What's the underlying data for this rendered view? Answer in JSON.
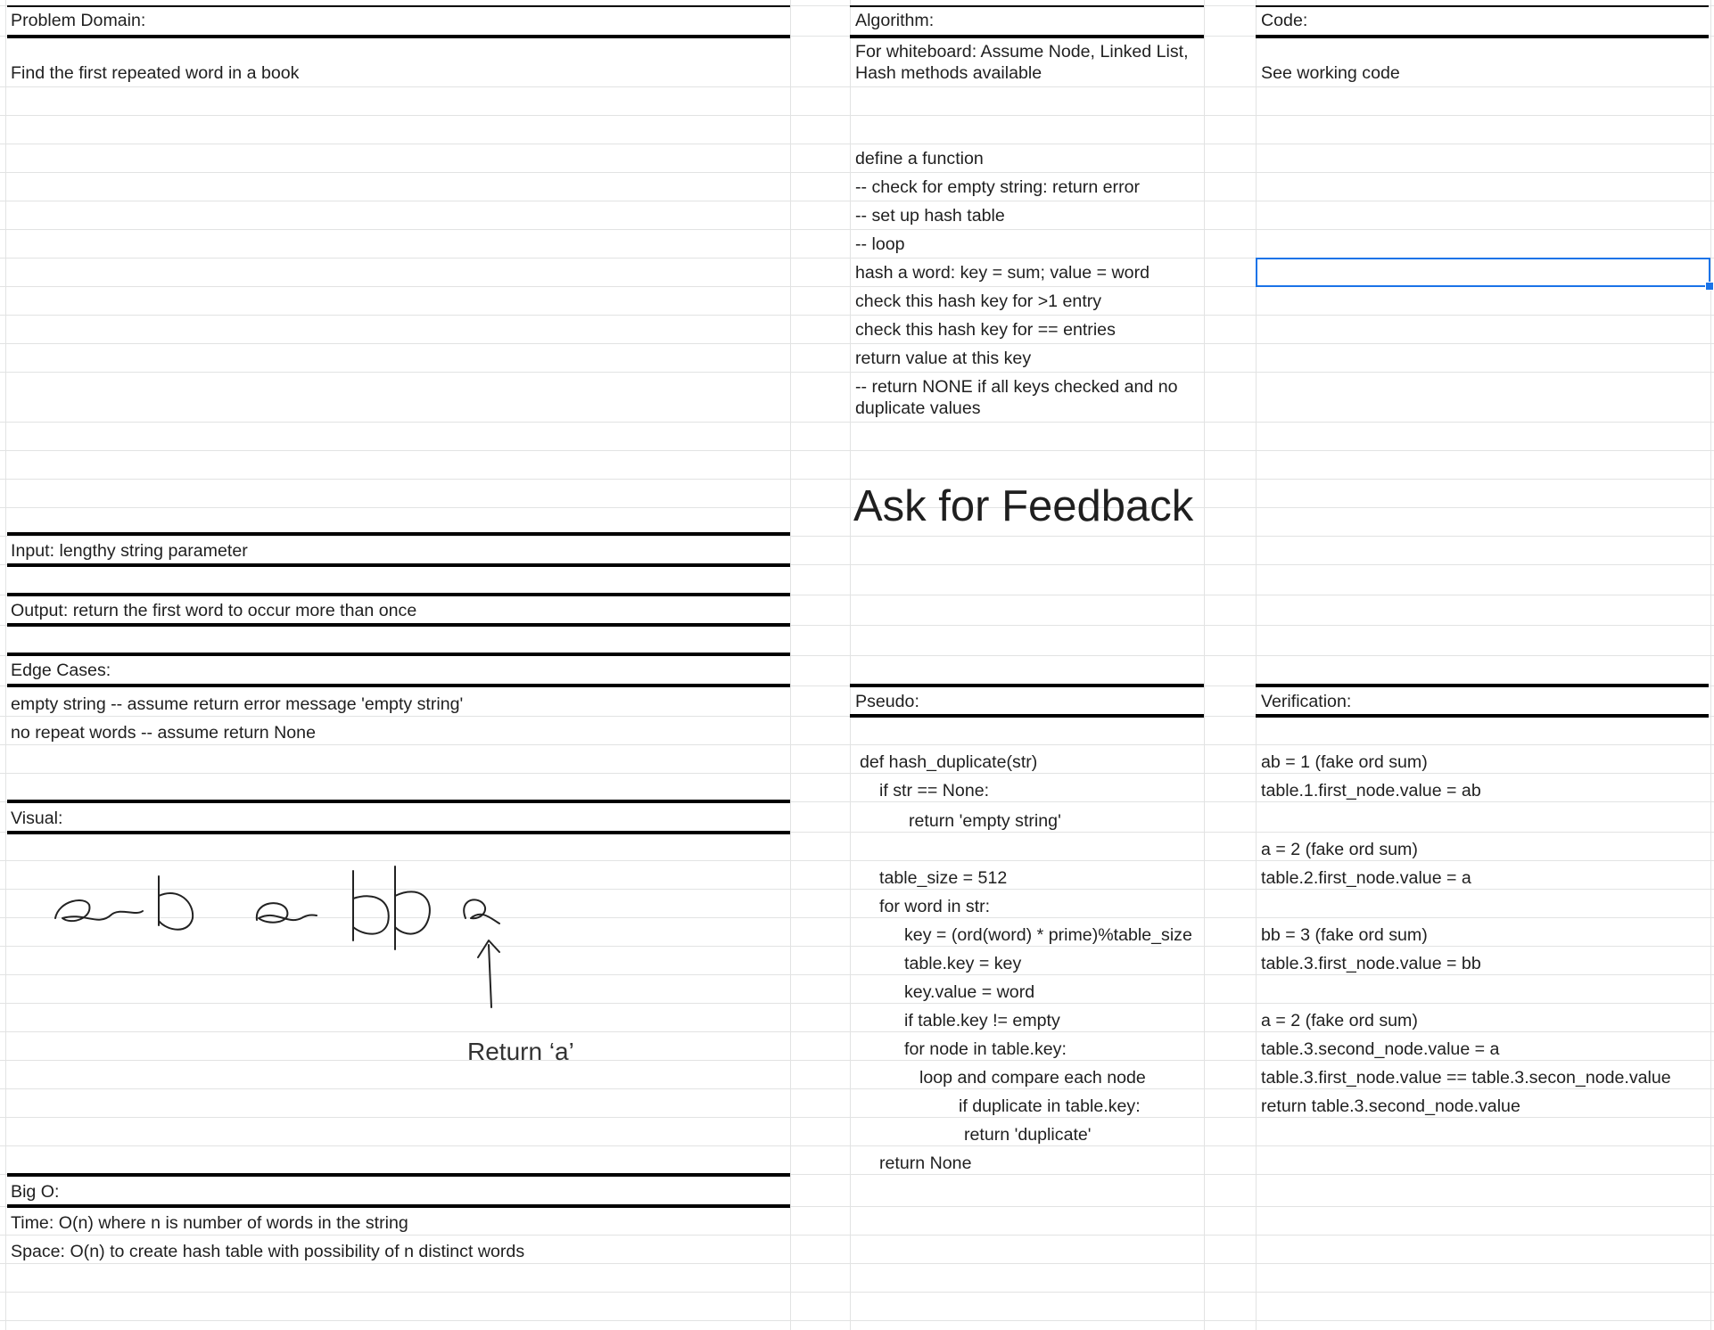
{
  "problem": {
    "header": "Problem Domain:",
    "text": "Find the first repeated word in a book"
  },
  "algorithm": {
    "header": "Algorithm:",
    "note": "For whiteboard: Assume Node, Linked List, Hash methods available",
    "steps": [
      "define a function",
      "-- check for empty string: return error",
      "-- set up hash table",
      "-- loop",
      "hash a word: key = sum; value = word",
      "check this hash key for >1 entry",
      "check this hash key for == entries",
      "return value at this key",
      "-- return NONE if all keys checked and no duplicate values"
    ],
    "feedback": "Ask for Feedback"
  },
  "code": {
    "header": "Code:",
    "text": "See working code"
  },
  "input": {
    "text": "Input:  lengthy string parameter"
  },
  "output": {
    "text": "Output: return the first word to occur more than once"
  },
  "edge": {
    "header": "Edge Cases:",
    "items": [
      "empty string -- assume return error message 'empty string'",
      "no repeat words -- assume return None"
    ]
  },
  "visual": {
    "header": "Visual:",
    "sketch_icon": "handwritten-sketch",
    "return_label": "Return ‘a’"
  },
  "bigo": {
    "header": "Big O:",
    "time": "Time: O(n) where n is number of words in the string",
    "space": "Space: O(n) to create hash table with possibility of n distinct words"
  },
  "pseudo": {
    "header": "Pseudo:",
    "lines": [
      "def  hash_duplicate(str)",
      "if str == None:",
      "return 'empty string'",
      "table_size = 512",
      "for word in str:",
      "key = (ord(word) * prime)%table_size",
      "table.key = key",
      "key.value = word",
      "if table.key != empty",
      "for node in table.key:",
      "loop and compare each node",
      "if duplicate in table.key:",
      "return 'duplicate'",
      "return None"
    ]
  },
  "verification": {
    "header": "Verification:",
    "lines": [
      " ab = 1 (fake ord sum)",
      "table.1.first_node.value = ab",
      "a = 2 (fake ord sum)",
      "table.2.first_node.value = a",
      "bb = 3 (fake ord sum)",
      "table.3.first_node.value = bb",
      "a = 2 (fake ord sum)",
      "table.3.second_node.value = a",
      "table.3.first_node.value == table.3.secon_node.value",
      "return table.3.second_node.value"
    ]
  },
  "colors": {
    "selection": "#1a73e8",
    "gridline": "#e2e3e3",
    "border": "#000000"
  }
}
